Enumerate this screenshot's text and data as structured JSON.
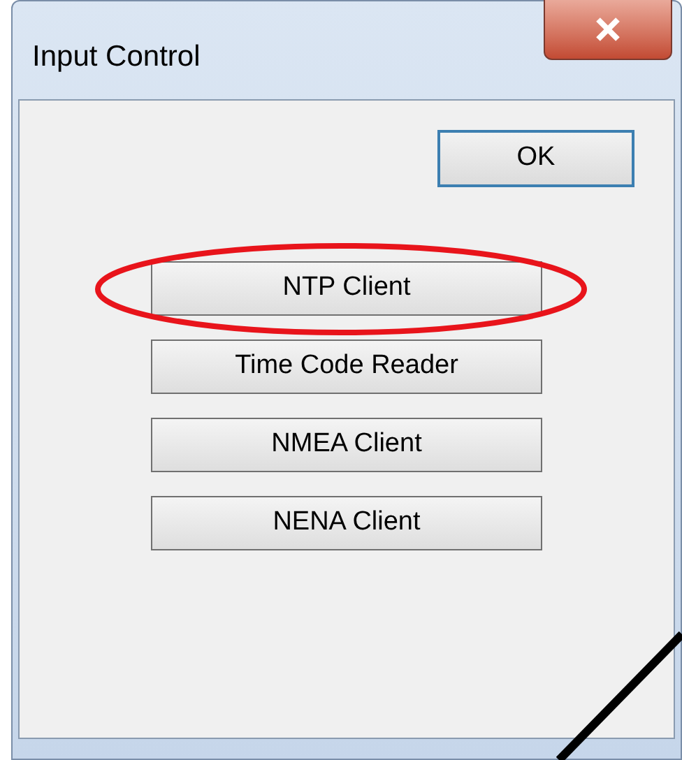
{
  "window": {
    "title": "Input Control"
  },
  "ok_button": {
    "label": "OK"
  },
  "buttons": [
    {
      "label": "NTP Client",
      "highlighted": true
    },
    {
      "label": "Time Code Reader",
      "highlighted": false
    },
    {
      "label": "NMEA Client",
      "highlighted": false
    },
    {
      "label": "NENA Client",
      "highlighted": false
    }
  ]
}
